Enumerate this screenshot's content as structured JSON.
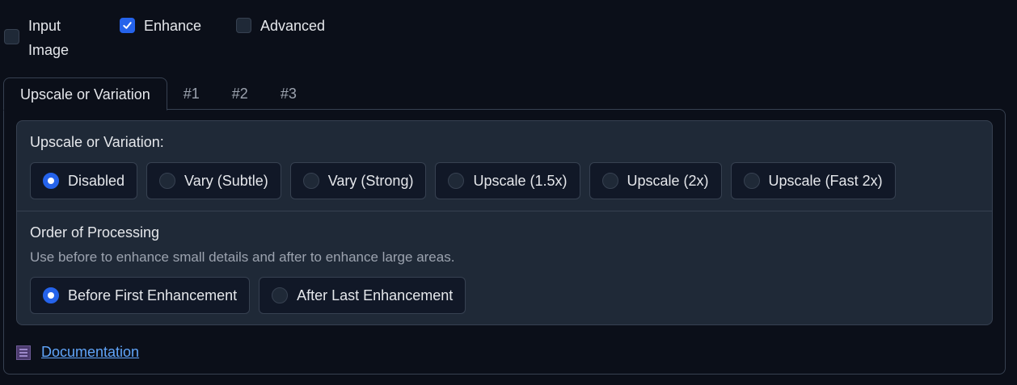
{
  "checkboxes": {
    "input_image": {
      "label": "Input Image",
      "checked": false
    },
    "enhance": {
      "label": "Enhance",
      "checked": true
    },
    "advanced": {
      "label": "Advanced",
      "checked": false
    }
  },
  "tabs": [
    {
      "label": "Upscale or Variation",
      "active": true
    },
    {
      "label": "#1",
      "active": false
    },
    {
      "label": "#2",
      "active": false
    },
    {
      "label": "#3",
      "active": false
    }
  ],
  "upscale": {
    "label": "Upscale or Variation:",
    "options": [
      "Disabled",
      "Vary (Subtle)",
      "Vary (Strong)",
      "Upscale (1.5x)",
      "Upscale (2x)",
      "Upscale (Fast 2x)"
    ],
    "selected": "Disabled"
  },
  "order": {
    "label": "Order of Processing",
    "info": "Use before to enhance small details and after to enhance large areas.",
    "options": [
      "Before First Enhancement",
      "After Last Enhancement"
    ],
    "selected": "Before First Enhancement"
  },
  "documentation": {
    "label": "Documentation",
    "icon": "document-icon"
  },
  "colors": {
    "accent": "#2563eb",
    "background": "#0b0f19",
    "panel": "#1f2937",
    "link": "#60a5fa"
  }
}
